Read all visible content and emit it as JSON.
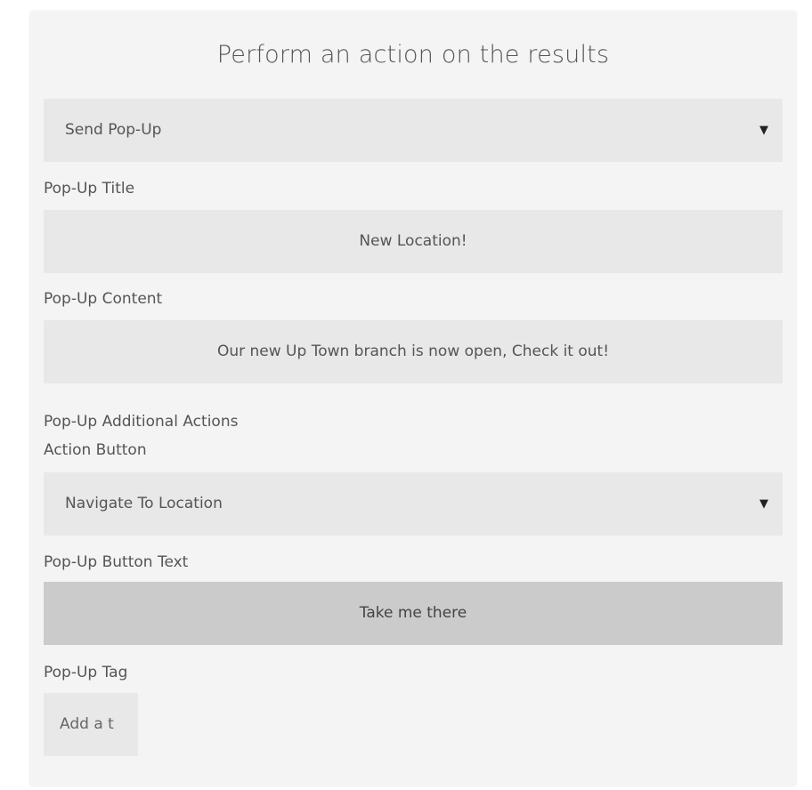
{
  "panel": {
    "title": "Perform an action on the results"
  },
  "action_select": {
    "value": "Send Pop-Up"
  },
  "popup_title": {
    "label": "Pop-Up Title",
    "value": "New Location!"
  },
  "popup_content": {
    "label": "Pop-Up Content",
    "value": "Our new Up Town branch is now open, Check it out!"
  },
  "additional_actions": {
    "label": "Pop-Up Additional Actions",
    "sub_label": "Action Button"
  },
  "action_button_select": {
    "value": "Navigate To Location"
  },
  "button_text": {
    "label": "Pop-Up Button Text",
    "value": "Take me there"
  },
  "popup_tag": {
    "label": "Pop-Up Tag",
    "placeholder": "Add a t"
  },
  "icons": {
    "caret": "▼"
  },
  "colors": {
    "panel_bg": "#f4f4f4",
    "field_bg": "#e8e8e8",
    "button_bg": "#cbcbcb",
    "text": "#555555"
  }
}
